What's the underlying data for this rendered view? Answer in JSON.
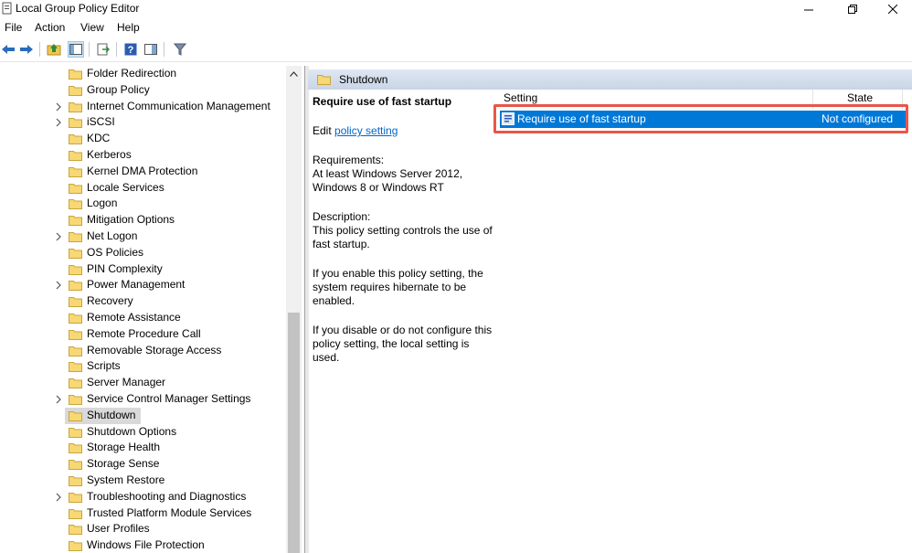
{
  "window": {
    "title": "Local Group Policy Editor",
    "controls": [
      "minimize",
      "restore",
      "close"
    ]
  },
  "menubar": {
    "items": [
      "File",
      "Action",
      "View",
      "Help"
    ]
  },
  "toolbar": {
    "icons": [
      "back-arrow-icon",
      "forward-arrow-icon",
      "up-folder-icon",
      "show-hide-tree-icon",
      "export-list-icon",
      "help-icon",
      "properties-icon",
      "filter-icon"
    ]
  },
  "tree": {
    "items": [
      {
        "label": "Folder Redirection",
        "expandable": false
      },
      {
        "label": "Group Policy",
        "expandable": false
      },
      {
        "label": "Internet Communication Management",
        "expandable": true
      },
      {
        "label": "iSCSI",
        "expandable": true
      },
      {
        "label": "KDC",
        "expandable": false
      },
      {
        "label": "Kerberos",
        "expandable": false
      },
      {
        "label": "Kernel DMA Protection",
        "expandable": false
      },
      {
        "label": "Locale Services",
        "expandable": false
      },
      {
        "label": "Logon",
        "expandable": false
      },
      {
        "label": "Mitigation Options",
        "expandable": false
      },
      {
        "label": "Net Logon",
        "expandable": true
      },
      {
        "label": "OS Policies",
        "expandable": false
      },
      {
        "label": "PIN Complexity",
        "expandable": false
      },
      {
        "label": "Power Management",
        "expandable": true
      },
      {
        "label": "Recovery",
        "expandable": false
      },
      {
        "label": "Remote Assistance",
        "expandable": false
      },
      {
        "label": "Remote Procedure Call",
        "expandable": false
      },
      {
        "label": "Removable Storage Access",
        "expandable": false
      },
      {
        "label": "Scripts",
        "expandable": false
      },
      {
        "label": "Server Manager",
        "expandable": false
      },
      {
        "label": "Service Control Manager Settings",
        "expandable": true
      },
      {
        "label": "Shutdown",
        "expandable": false,
        "selected": true
      },
      {
        "label": "Shutdown Options",
        "expandable": false
      },
      {
        "label": "Storage Health",
        "expandable": false
      },
      {
        "label": "Storage Sense",
        "expandable": false
      },
      {
        "label": "System Restore",
        "expandable": false
      },
      {
        "label": "Troubleshooting and Diagnostics",
        "expandable": true
      },
      {
        "label": "Trusted Platform Module Services",
        "expandable": false
      },
      {
        "label": "User Profiles",
        "expandable": false
      },
      {
        "label": "Windows File Protection",
        "expandable": false
      }
    ]
  },
  "panel": {
    "header": "Shutdown",
    "policy_title": "Require use of fast startup",
    "edit_prefix": "Edit ",
    "edit_link": "policy setting ",
    "requirements_label": "Requirements:",
    "requirements_text": "At least Windows Server 2012, Windows 8 or Windows RT",
    "description_label": "Description:",
    "description_text": "This policy setting controls the use of fast startup.",
    "enable_text": "If you enable this policy setting, the system requires hibernate to be enabled.",
    "disable_text": "If you disable or do not configure this policy setting, the local setting is used."
  },
  "list": {
    "columns": [
      "Setting",
      "State"
    ],
    "rows": [
      {
        "setting": "Require use of fast startup",
        "state": "Not configured",
        "selected": true
      }
    ]
  },
  "colors": {
    "selection": "#0078d7",
    "highlight_box": "#e8564a",
    "link": "#0066cc",
    "folder": "#f8d775"
  }
}
